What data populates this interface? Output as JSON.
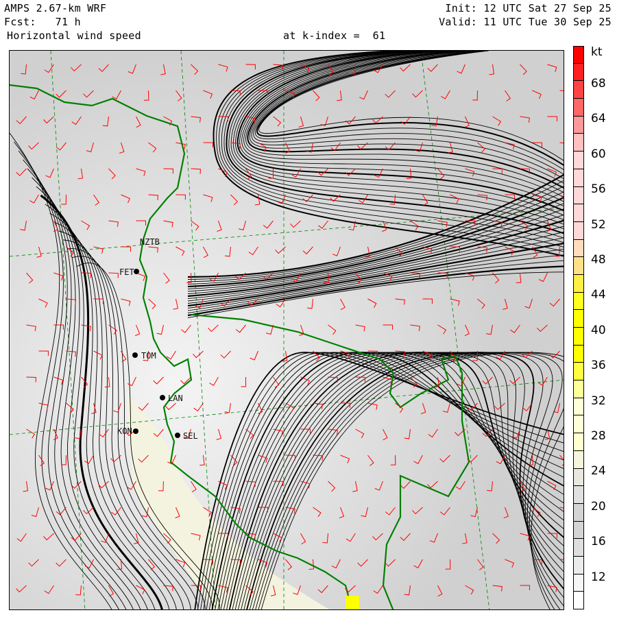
{
  "header": {
    "model": "AMPS 2.67-km WRF",
    "forecast": "Fcst:   71 h",
    "field": "Horizontal wind speed",
    "level": "at k-index =  61",
    "init": "Init: 12 UTC Sat 27 Sep 25",
    "valid": "Valid: 11 UTC Tue 30 Sep 25"
  },
  "colorbar": {
    "unit": "kt",
    "labels": [
      "68",
      "64",
      "60",
      "56",
      "52",
      "48",
      "44",
      "40",
      "36",
      "32",
      "28",
      "24",
      "20",
      "16",
      "12"
    ],
    "colors_top_to_bottom": [
      "#ff0000",
      "#ff2020",
      "#ff4444",
      "#ff6666",
      "#ff9999",
      "#ffc0c0",
      "#ffd8d8",
      "#ffd8d8",
      "#ffd8d8",
      "#ffd8d8",
      "#ffd8d8",
      "#ffdcbc",
      "#ffe088",
      "#ffee44",
      "#ffff20",
      "#ffff00",
      "#ffff00",
      "#ffff00",
      "#ffff40",
      "#ffff99",
      "#ffffd8",
      "#ffffd8",
      "#ffffd0",
      "#f5f5dc",
      "#e8e8dc",
      "#e0e0e0",
      "#d4d4d4",
      "#d4d4d4",
      "#dedede",
      "#ebebeb",
      "#f6f6f6",
      "#ffffff"
    ]
  },
  "stations": [
    {
      "id": "NZTB"
    },
    {
      "id": "FET"
    },
    {
      "id": "TOM"
    },
    {
      "id": "LAN"
    },
    {
      "id": "KON"
    },
    {
      "id": "SEL"
    }
  ],
  "colors": {
    "coast": "#008000",
    "barbs": "#ff0000",
    "streamlines": "#000000",
    "grid": "#008000"
  }
}
